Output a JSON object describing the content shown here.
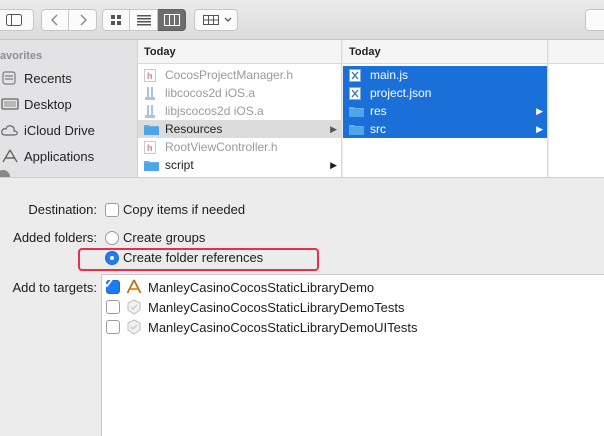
{
  "sidebar": {
    "heading": "avorites",
    "items": [
      {
        "label": "Recents",
        "icon": "recents-icon"
      },
      {
        "label": "Desktop",
        "icon": "desktop-icon"
      },
      {
        "label": "iCloud Drive",
        "icon": "cloud-icon"
      },
      {
        "label": "Applications",
        "icon": "applications-icon"
      }
    ]
  },
  "column1": {
    "header": "Today",
    "items": [
      {
        "label": "CocosProjectManager.h",
        "icon": "header-file-icon",
        "state": "dim"
      },
      {
        "label": "libcocos2d iOS.a",
        "icon": "library-file-icon",
        "state": "dim"
      },
      {
        "label": "libjscocos2d iOS.a",
        "icon": "library-file-icon",
        "state": "dim"
      },
      {
        "label": "Resources",
        "icon": "folder-icon",
        "state": "selected"
      },
      {
        "label": "RootViewController.h",
        "icon": "header-file-icon",
        "state": "dim"
      },
      {
        "label": "script",
        "icon": "folder-icon",
        "state": "normal"
      }
    ]
  },
  "column2": {
    "header": "Today",
    "items": [
      {
        "label": "main.js",
        "icon": "js-file-icon"
      },
      {
        "label": "project.json",
        "icon": "json-file-icon"
      },
      {
        "label": "res",
        "icon": "folder-icon"
      },
      {
        "label": "src",
        "icon": "folder-icon"
      }
    ]
  },
  "options": {
    "destination_label": "Destination:",
    "copy_items_label": "Copy items if needed",
    "added_folders_label": "Added folders:",
    "create_groups_label": "Create groups",
    "create_folder_refs_label": "Create folder references",
    "add_to_targets_label": "Add to targets:",
    "targets": [
      {
        "name": "ManleyCasinoCocosStaticLibraryDemo",
        "checked": true,
        "icon": "app-target-icon"
      },
      {
        "name": "ManleyCasinoCocosStaticLibraryDemoTests",
        "checked": false,
        "icon": "test-target-icon"
      },
      {
        "name": "ManleyCasinoCocosStaticLibraryDemoUITests",
        "checked": false,
        "icon": "test-target-icon"
      }
    ]
  },
  "colors": {
    "selection_blue": "#1a6fd8",
    "checkbox_blue": "#1d7bf5",
    "highlight_red": "#e5304a"
  }
}
